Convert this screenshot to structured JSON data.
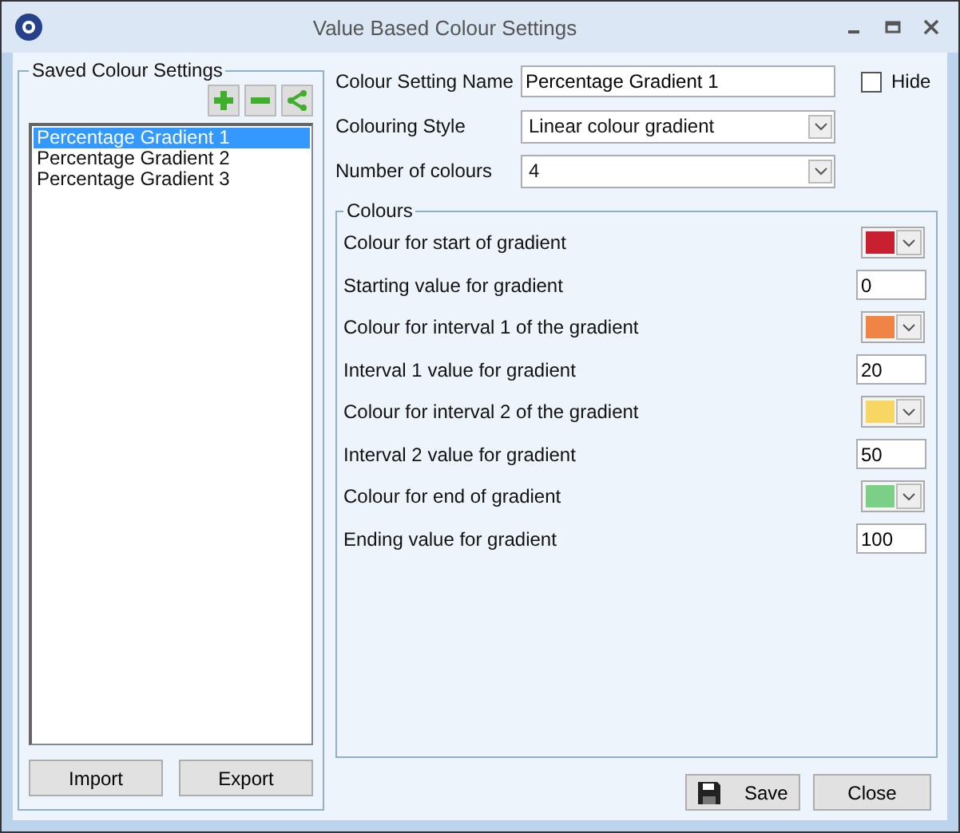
{
  "window": {
    "title": "Value Based Colour Settings"
  },
  "saved": {
    "title": "Saved Colour Settings",
    "items": [
      {
        "label": "Percentage Gradient 1",
        "selected": true
      },
      {
        "label": "Percentage Gradient 2",
        "selected": false
      },
      {
        "label": "Percentage Gradient 3",
        "selected": false
      }
    ],
    "import_label": "Import",
    "export_label": "Export"
  },
  "name_label": "Colour Setting Name",
  "name_value": "Percentage Gradient 1",
  "hide": {
    "label": "Hide",
    "checked": false
  },
  "style_label": "Colouring Style",
  "style_value": "Linear colour gradient",
  "count_label": "Number of colours",
  "count_value": "4",
  "colours": {
    "title": "Colours",
    "rows": [
      {
        "kind": "colour",
        "label": "Colour for start of gradient",
        "color": "#c8202e"
      },
      {
        "kind": "value",
        "label": "Starting value for gradient",
        "value": "0"
      },
      {
        "kind": "colour",
        "label": "Colour for interval 1 of the gradient",
        "color": "#ee8446"
      },
      {
        "kind": "value",
        "label": "Interval 1 value for gradient",
        "value": "20"
      },
      {
        "kind": "colour",
        "label": "Colour for interval 2 of the gradient",
        "color": "#f7d664"
      },
      {
        "kind": "value",
        "label": "Interval 2 value for gradient",
        "value": "50"
      },
      {
        "kind": "colour",
        "label": "Colour for end of gradient",
        "color": "#7ccf86"
      },
      {
        "kind": "value",
        "label": "Ending value for gradient",
        "value": "100"
      }
    ]
  },
  "save_label": "Save",
  "close_label": "Close"
}
